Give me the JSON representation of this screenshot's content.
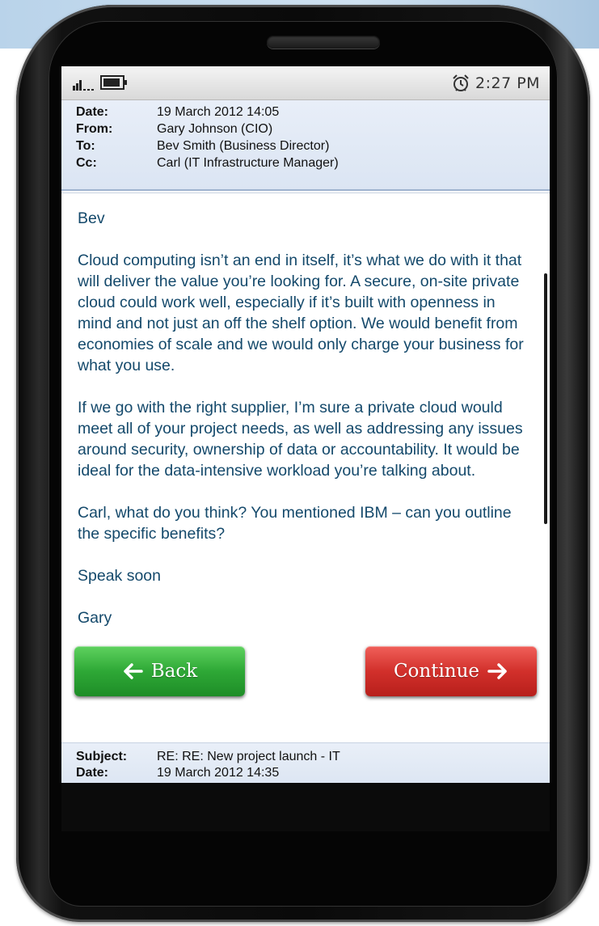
{
  "status_bar": {
    "time": "2:27 PM",
    "icons": [
      "signal-icon",
      "battery-icon",
      "alarm-icon"
    ]
  },
  "email": {
    "meta": [
      {
        "label": "Date:",
        "value": "19 March 2012 14:05"
      },
      {
        "label": "From:",
        "value": "Gary Johnson (CIO)"
      },
      {
        "label": "To:",
        "value": "Bev Smith (Business Director)"
      },
      {
        "label": "Cc:",
        "value": "Carl (IT Infrastructure Manager)"
      }
    ],
    "body": [
      "Bev",
      "Cloud computing isn’t an end in itself, it’s what we do with it that will deliver the value you’re looking for. A secure, on-site private cloud could work well, especially if it’s built with openness in mind and not just an off the shelf option. We would benefit from economies of scale and we would only charge your business for what you use.",
      "If we go with the right supplier, I’m sure a private cloud would meet all of your project needs, as well as addressing any issues around security, ownership of data or accountability. It would be ideal for the data-intensive workload you’re talking about.",
      "Carl, what do you think? You mentioned IBM – can you outline the specific benefits?",
      "Speak soon",
      "Gary"
    ]
  },
  "next_email": {
    "meta": [
      {
        "label": "Subject:",
        "value": "RE: RE: New project launch - IT"
      },
      {
        "label": "Date:",
        "value": "19 March 2012 14:35"
      }
    ]
  },
  "buttons": {
    "back_label": "Back",
    "continue_label": "Continue"
  },
  "colors": {
    "back_button": "#2ea836",
    "continue_button": "#d2302b",
    "body_text": "#14496b",
    "header_bg": "#dbe5f3"
  }
}
